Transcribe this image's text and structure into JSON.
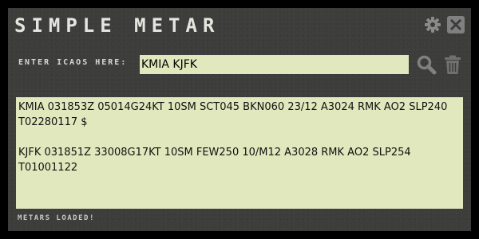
{
  "app": {
    "title": "Simple Metar"
  },
  "window_controls": {
    "settings_icon": "gear-icon",
    "close_icon": "close-icon"
  },
  "search": {
    "label": "Enter ICAOs Here:",
    "value": "KMIA KJFK",
    "search_icon": "search-icon",
    "clear_icon": "trash-icon"
  },
  "metars": [
    "KMIA 031853Z 05014G24KT 10SM SCT045 BKN060 23/12 A3024 RMK AO2 SLP240 T02280117 $",
    "KJFK 031851Z 33008G17KT 10SM FEW250 10/M12 A3028 RMK AO2 SLP254 T01001122"
  ],
  "status": {
    "text": "Metars Loaded!"
  },
  "colors": {
    "background": "#3d3d3b",
    "panel": "#e1e8bd",
    "text_light": "#e5e5e0"
  }
}
